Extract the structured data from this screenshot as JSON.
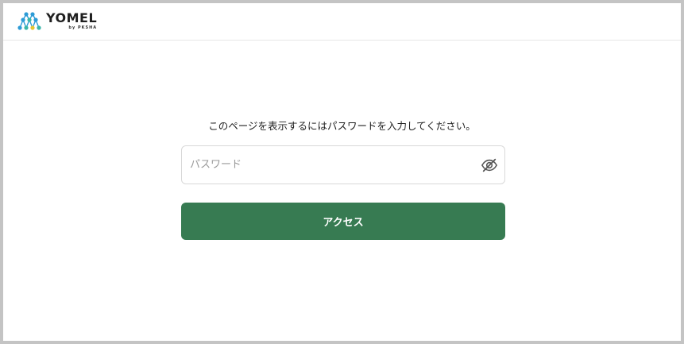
{
  "brand": {
    "name": "YOMEL",
    "byline": "by PKSHA"
  },
  "page": {
    "message": "このページを表示するにはパスワードを入力してください。"
  },
  "password": {
    "placeholder": "パスワード",
    "value": "",
    "toggle_icon": "eye-off-icon"
  },
  "access_button": {
    "label": "アクセス"
  },
  "colors": {
    "button": "#377b52",
    "logo_blue": "#2d9bd6",
    "logo_teal": "#39b6a9",
    "logo_yellow": "#e4c531"
  }
}
